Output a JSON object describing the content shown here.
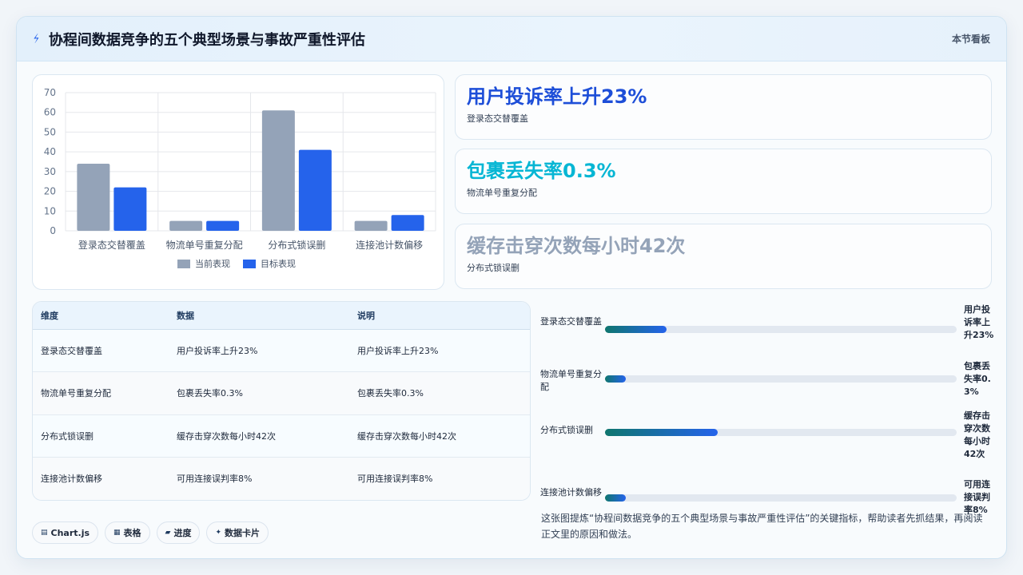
{
  "header": {
    "title": "协程间数据竞争的五个典型场景与事故严重性评估",
    "right_label": "本节看板"
  },
  "colors": {
    "current": "#94a3b8",
    "target": "#2563eb",
    "card1": "#1d4ed8",
    "card2": "#06b6d4",
    "card3": "#94a3b8"
  },
  "chart_data": {
    "type": "bar",
    "categories": [
      "登录态交替覆盖",
      "物流单号重复分配",
      "分布式锁误删",
      "连接池计数偏移"
    ],
    "series": [
      {
        "name": "当前表现",
        "values": [
          34,
          5,
          61,
          5
        ]
      },
      {
        "name": "目标表现",
        "values": [
          22,
          5,
          41,
          8
        ]
      }
    ],
    "yticks": [
      "0",
      "10",
      "20",
      "30",
      "40",
      "50",
      "60",
      "70"
    ],
    "ylim": [
      0,
      70
    ],
    "grid": true,
    "legend": "bottom"
  },
  "cards": [
    {
      "big": "用户投诉率上升23%",
      "sub": "登录态交替覆盖"
    },
    {
      "big": "包裹丢失率0.3%",
      "sub": "物流单号重复分配"
    },
    {
      "big": "缓存击穿次数每小时42次",
      "sub": "分布式锁误删"
    }
  ],
  "table": {
    "headers": [
      "维度",
      "数据",
      "说明"
    ],
    "rows": [
      [
        "登录态交替覆盖",
        "用户投诉率上升23%",
        "用户投诉率上升23%"
      ],
      [
        "物流单号重复分配",
        "包裹丢失率0.3%",
        "包裹丢失率0.3%"
      ],
      [
        "分布式锁误删",
        "缓存击穿次数每小时42次",
        "缓存击穿次数每小时42次"
      ],
      [
        "连接池计数偏移",
        "可用连接误判率8%",
        "可用连接误判率8%"
      ]
    ]
  },
  "progress": [
    {
      "label": "登录态交替覆盖",
      "value": "用户投诉率上升23%",
      "fraction": 0.175
    },
    {
      "label": "物流单号重复分配",
      "value": "包裹丢失率0.3%",
      "fraction": 0.06
    },
    {
      "label": "分布式锁误删",
      "value": "缓存击穿次数每小时42次",
      "fraction": 0.32
    },
    {
      "label": "连接池计数偏移",
      "value": "可用连接误判率8%",
      "fraction": 0.06
    }
  ],
  "note": "这张图提炼“协程间数据竞争的五个典型场景与事故严重性评估”的关键指标，帮助读者先抓结果，再阅读正文里的原因和做法。",
  "tags": [
    {
      "icon": "chart-icon",
      "label": "Chart.js"
    },
    {
      "icon": "table-icon",
      "label": "表格"
    },
    {
      "icon": "progress-icon",
      "label": "进度"
    },
    {
      "icon": "card-icon",
      "label": "数据卡片"
    }
  ]
}
